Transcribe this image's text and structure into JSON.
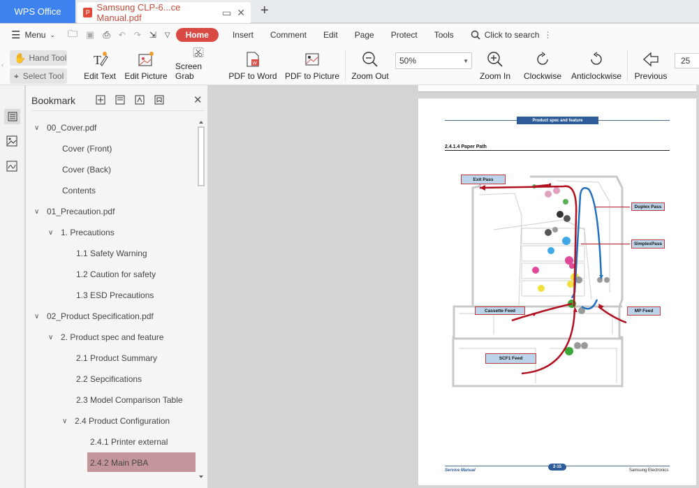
{
  "tabs": {
    "app_tab": "WPS Office",
    "doc_tab": "Samsung CLP-6...ce Manual.pdf",
    "new_tab": "+"
  },
  "menu": {
    "menu_label": "Menu",
    "items": [
      "Home",
      "Insert",
      "Comment",
      "Edit",
      "Page",
      "Protect",
      "Tools"
    ],
    "search_label": "Click to search"
  },
  "ribbon": {
    "hand_tool": "Hand Tool",
    "select_tool": "Select Tool",
    "edit_text": "Edit Text",
    "edit_picture": "Edit Picture",
    "screen_grab": "Screen Grab",
    "pdf_to_word": "PDF to Word",
    "pdf_to_picture": "PDF to Picture",
    "zoom_out": "Zoom Out",
    "zoom_value": "50%",
    "zoom_in": "Zoom In",
    "clockwise": "Clockwise",
    "anticlockwise": "Anticlockwise",
    "previous": "Previous",
    "page_num": "25"
  },
  "bookmark": {
    "title": "Bookmark",
    "items": [
      "00_Cover.pdf",
      "Cover (Front)",
      "Cover (Back)",
      "Contents",
      "01_Precaution.pdf",
      "1. Precautions",
      "1.1 Safety Warning",
      "1.2 Caution for safety",
      "1.3 ESD Precautions",
      "02_Product Specification.pdf",
      "2. Product spec and feature",
      "2.1 Product Summary",
      "2.2 Sepcifications",
      "2.3 Model Comparison Table",
      "2.4 Product Configuration",
      "2.4.1 Printer external",
      "2.4.2 Main PBA"
    ]
  },
  "document": {
    "header_tag": "Product spec and feature",
    "section_title": "2.4.1.4 Paper Path",
    "labels": {
      "exit_pass": "Exit Pass",
      "duplex_pass": "Duplex Pass",
      "simplex_pass": "SimplexPass",
      "cassette_feed": "Cassette Feed",
      "mp_feed": "MP Feed",
      "scf1_feed": "SCF1 Feed"
    },
    "footer_left": "Service Manual",
    "footer_page": "2-15",
    "footer_right": "Samsung Electronics"
  },
  "colors": {
    "brand_blue": "#3e82f0",
    "home_red": "#d84b45",
    "selected_bookmark": "#c4969c",
    "path_red": "#b01020",
    "path_blue": "#2070c0"
  }
}
